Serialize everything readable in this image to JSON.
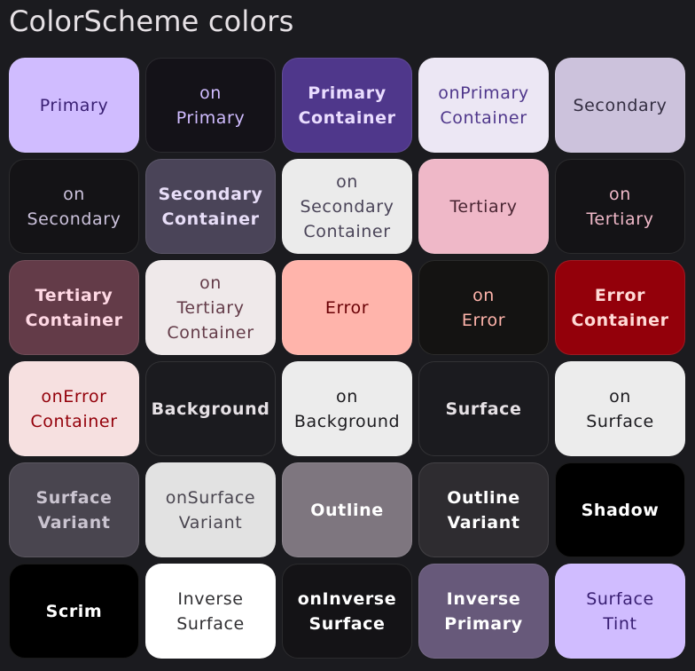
{
  "page": {
    "title": "ColorScheme colors"
  },
  "tiles": [
    {
      "label": "Primary",
      "bg": "#d0bcff",
      "fg": "#381e72",
      "bold": false
    },
    {
      "label": "on\nPrimary",
      "bg": "#141218",
      "fg": "#d0bcff",
      "bold": false
    },
    {
      "label": "Primary\nContainer",
      "bg": "#4f378b",
      "fg": "#eaddff",
      "bold": true
    },
    {
      "label": "onPrimary\nContainer",
      "bg": "#ece7f4",
      "fg": "#4f378b",
      "bold": false
    },
    {
      "label": "Secondary",
      "bg": "#ccc2dc",
      "fg": "#332d41",
      "bold": false
    },
    {
      "label": "on\nSecondary",
      "bg": "#141316",
      "fg": "#ccc2dc",
      "bold": false
    },
    {
      "label": "Secondary\nContainer",
      "bg": "#4a4458",
      "fg": "#e8def8",
      "bold": true
    },
    {
      "label": "on\nSecondary\nContainer",
      "bg": "#ebebeb",
      "fg": "#4a4458",
      "bold": false
    },
    {
      "label": "Tertiary",
      "bg": "#efb8c8",
      "fg": "#492532",
      "bold": false
    },
    {
      "label": "on\nTertiary",
      "bg": "#141316",
      "fg": "#efb8c8",
      "bold": false
    },
    {
      "label": "Tertiary\nContainer",
      "bg": "#633b48",
      "fg": "#ffd8e4",
      "bold": true
    },
    {
      "label": "on\nTertiary\nContainer",
      "bg": "#efe9ea",
      "fg": "#633b48",
      "bold": false
    },
    {
      "label": "Error",
      "bg": "#ffb4ab",
      "fg": "#690005",
      "bold": false
    },
    {
      "label": "on\nError",
      "bg": "#141312",
      "fg": "#ffb4ab",
      "bold": false
    },
    {
      "label": "Error\nContainer",
      "bg": "#93000a",
      "fg": "#ffdad6",
      "bold": true
    },
    {
      "label": "onError\nContainer",
      "bg": "#f6e0e0",
      "fg": "#93000a",
      "bold": false
    },
    {
      "label": "Background",
      "bg": "#1b1b1f",
      "fg": "#e6e1e5",
      "bold": true
    },
    {
      "label": "on\nBackground",
      "bg": "#ececec",
      "fg": "#1c1b1f",
      "bold": false
    },
    {
      "label": "Surface",
      "bg": "#1b1b1f",
      "fg": "#e6e1e5",
      "bold": true
    },
    {
      "label": "on\nSurface",
      "bg": "#ececec",
      "fg": "#1c1b1f",
      "bold": false
    },
    {
      "label": "Surface\nVariant",
      "bg": "#49454f",
      "fg": "#cac4d0",
      "bold": true
    },
    {
      "label": "onSurface\nVariant",
      "bg": "#e2e2e2",
      "fg": "#49454f",
      "bold": false
    },
    {
      "label": "Outline",
      "bg": "#7e767f",
      "fg": "#ffffff",
      "bold": true
    },
    {
      "label": "Outline\nVariant",
      "bg": "#2e2c30",
      "fg": "#ffffff",
      "bold": true
    },
    {
      "label": "Shadow",
      "bg": "#000000",
      "fg": "#ffffff",
      "bold": true
    },
    {
      "label": "Scrim",
      "bg": "#000000",
      "fg": "#ffffff",
      "bold": true
    },
    {
      "label": "Inverse\nSurface",
      "bg": "#ffffff",
      "fg": "#313033",
      "bold": false
    },
    {
      "label": "onInverse\nSurface",
      "bg": "#141316",
      "fg": "#ffffff",
      "bold": true
    },
    {
      "label": "Inverse\nPrimary",
      "bg": "#67597a",
      "fg": "#ffffff",
      "bold": true
    },
    {
      "label": "Surface\nTint",
      "bg": "#d0bcff",
      "fg": "#381e72",
      "bold": false
    }
  ]
}
